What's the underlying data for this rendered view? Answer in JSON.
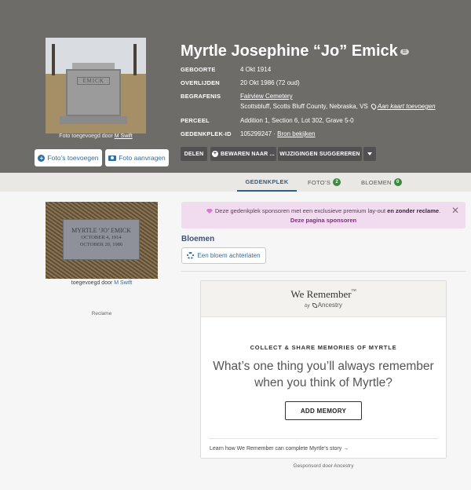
{
  "header": {
    "name": "Myrtle Josephine “Jo” Emick",
    "badge_symbol": "☰",
    "photo_caption_prefix": "Foto toegevoegd door",
    "photo_caption_user": "M Swift",
    "stone_inscription": "EMICK",
    "add_photos_label": "Foto’s toevoegen",
    "request_photo_label": "Foto aanvragen",
    "facts": {
      "birth_label": "GEBOORTE",
      "birth_value": "4 Okt 1914",
      "death_label": "OVERLIJDEN",
      "death_value": "20 Okt 1986 (72 oud)",
      "burial_label": "BEGRAFENIS",
      "cemetery": "Fairview Cemetery",
      "location": "Scottsbluff, Scotts Bluff County, Nebraska, VS",
      "add_to_map": "Aan kaart toevoegen",
      "plot_label": "PERCEEL",
      "plot_value": "Addition 1, Section 6, Lot 302, Grave 5-0",
      "memorial_id_label": "GEDENKPLEK-ID",
      "memorial_id_value": "105299247",
      "source_link": "Bron bekijken"
    },
    "actions": {
      "share": "DELEN",
      "save_to": "BEWAREN NAAR ...",
      "suggest": "WIJZIGINGEN SUGGEREREN"
    }
  },
  "tabs": {
    "memorial": "GEDENKPLEK",
    "photos": "FOTO’S",
    "photos_count": "2",
    "flowers": "BLOEMEN",
    "flowers_count": "0"
  },
  "side": {
    "stone_line1": "MYRTLE ‘JO’ EMICK",
    "stone_line2": "OCTOBER 4, 1914",
    "stone_line3": "OCTOBER 20, 1986",
    "caption_prefix": "toegevoegd door",
    "caption_user": "M Swift",
    "ad_label": "Reclame"
  },
  "sponsor": {
    "text_before": "Deze gedenkplek sponsoren met een exclusieve premium lay-out",
    "text_bold": "en zonder reclame",
    "text_after": ".",
    "link": "Deze pagina sponsoren",
    "close": "✕"
  },
  "flowers": {
    "heading": "Bloemen",
    "leave_flower": "Een bloem achterlaten"
  },
  "card": {
    "brand": "We Remember",
    "tm": "TM",
    "by": "by",
    "ancestry": "Ancestry",
    "kicker": "COLLECT & SHARE MEMORIES OF MYRTLE",
    "question": "What’s one thing you’ll always remember when you think of Myrtle?",
    "button": "ADD MEMORY",
    "footer": "Learn how We Remember can complete Myrtle’s story →"
  },
  "sponsored_by": "Gesponsord door Ancestry",
  "colors": {
    "header_bg": "#6e6c68",
    "link_blue": "#2d6ea3",
    "tab_active": "#2a5f8e",
    "count_green": "#3d8a3d",
    "sponsor_bg": "#f1dcef"
  }
}
